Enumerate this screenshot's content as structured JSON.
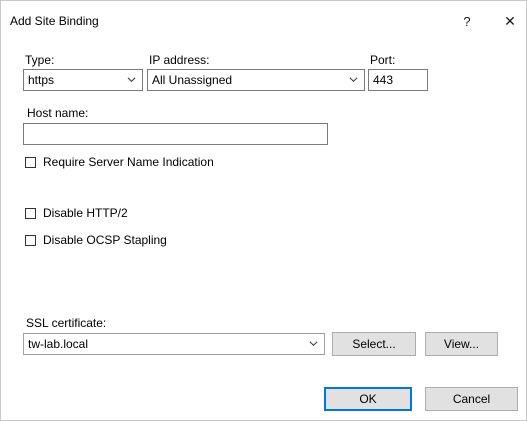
{
  "window": {
    "title": "Add Site Binding",
    "help_glyph": "?",
    "close_glyph": "✕"
  },
  "binding": {
    "type_label": "Type:",
    "type_value": "https",
    "ip_label": "IP address:",
    "ip_value": "All Unassigned",
    "port_label": "Port:",
    "port_value": "443",
    "host_label": "Host name:",
    "host_value": ""
  },
  "options": {
    "sni_label": "Require Server Name Indication",
    "http2_label": "Disable HTTP/2",
    "ocsp_label": "Disable OCSP Stapling",
    "sni_checked": false,
    "http2_checked": false,
    "ocsp_checked": false
  },
  "ssl": {
    "label": "SSL certificate:",
    "value": "tw-lab.local",
    "select_label": "Select...",
    "view_label": "View..."
  },
  "actions": {
    "ok_label": "OK",
    "cancel_label": "Cancel"
  },
  "colors": {
    "default_button_border": "#0078d7",
    "button_face": "#e1e1e1"
  },
  "icons": {
    "help": "question-mark-icon",
    "close": "close-icon",
    "dropdown": "chevron-down-icon"
  }
}
